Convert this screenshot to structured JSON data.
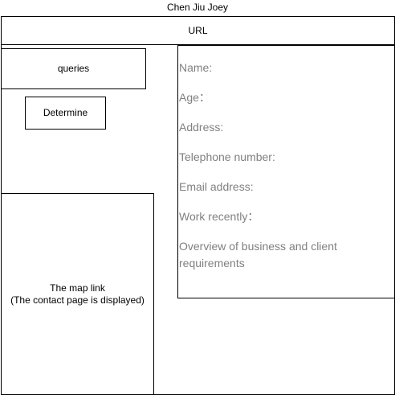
{
  "title": "Chen Jiu Joey",
  "url_bar": {
    "label": "URL"
  },
  "queries": {
    "label": "queries"
  },
  "determine": {
    "label": "Determine"
  },
  "map": {
    "line1": "The map link",
    "line2": "(The contact page is displayed)"
  },
  "info_fields": [
    "Name:",
    "Age：",
    "Address:",
    "Telephone number:",
    "Email address:",
    "Work recently：",
    "Overview of business and client requirements"
  ],
  "colors": {
    "border": "#000000",
    "field_text": "#808080",
    "background": "#ffffff"
  }
}
